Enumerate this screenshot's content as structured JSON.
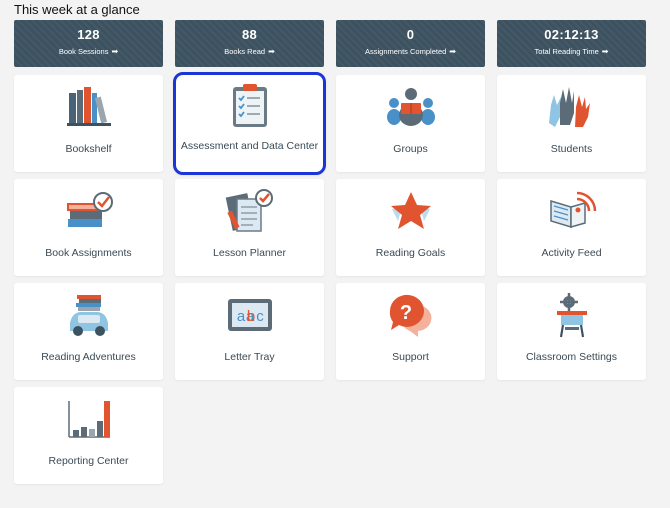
{
  "header": {
    "title": "This week at a glance"
  },
  "stats": [
    {
      "value": "128",
      "label": "Book Sessions",
      "arrow": "➡"
    },
    {
      "value": "88",
      "label": "Books Read",
      "arrow": "➡"
    },
    {
      "value": "0",
      "label": "Assignments Completed",
      "arrow": "➡"
    },
    {
      "value": "02:12:13",
      "label": "Total Reading Time",
      "arrow": "➡"
    }
  ],
  "tiles": [
    {
      "label": "Bookshelf",
      "icon": "bookshelf-icon"
    },
    {
      "label": "Assessment and Data Center",
      "icon": "clipboard-checklist-icon",
      "selected": true
    },
    {
      "label": "Groups",
      "icon": "groups-icon"
    },
    {
      "label": "Students",
      "icon": "raised-hands-icon"
    },
    {
      "label": "Book Assignments",
      "icon": "book-assignments-icon"
    },
    {
      "label": "Lesson Planner",
      "icon": "lesson-planner-icon"
    },
    {
      "label": "Reading Goals",
      "icon": "star-icon"
    },
    {
      "label": "Activity Feed",
      "icon": "activity-feed-icon"
    },
    {
      "label": "Reading Adventures",
      "icon": "car-with-books-icon"
    },
    {
      "label": "Letter Tray",
      "icon": "abc-tray-icon"
    },
    {
      "label": "Support",
      "icon": "question-bubble-icon"
    },
    {
      "label": "Classroom Settings",
      "icon": "desk-settings-icon"
    },
    {
      "label": "Reporting Center",
      "icon": "bar-chart-icon"
    }
  ],
  "colors": {
    "stat_background": "#3d5260",
    "tile_background": "#ffffff",
    "selection_outline": "#1a35d8",
    "accent_orange": "#e0552f",
    "icon_slate": "#5b6c78",
    "icon_blue": "#4a90c8"
  }
}
